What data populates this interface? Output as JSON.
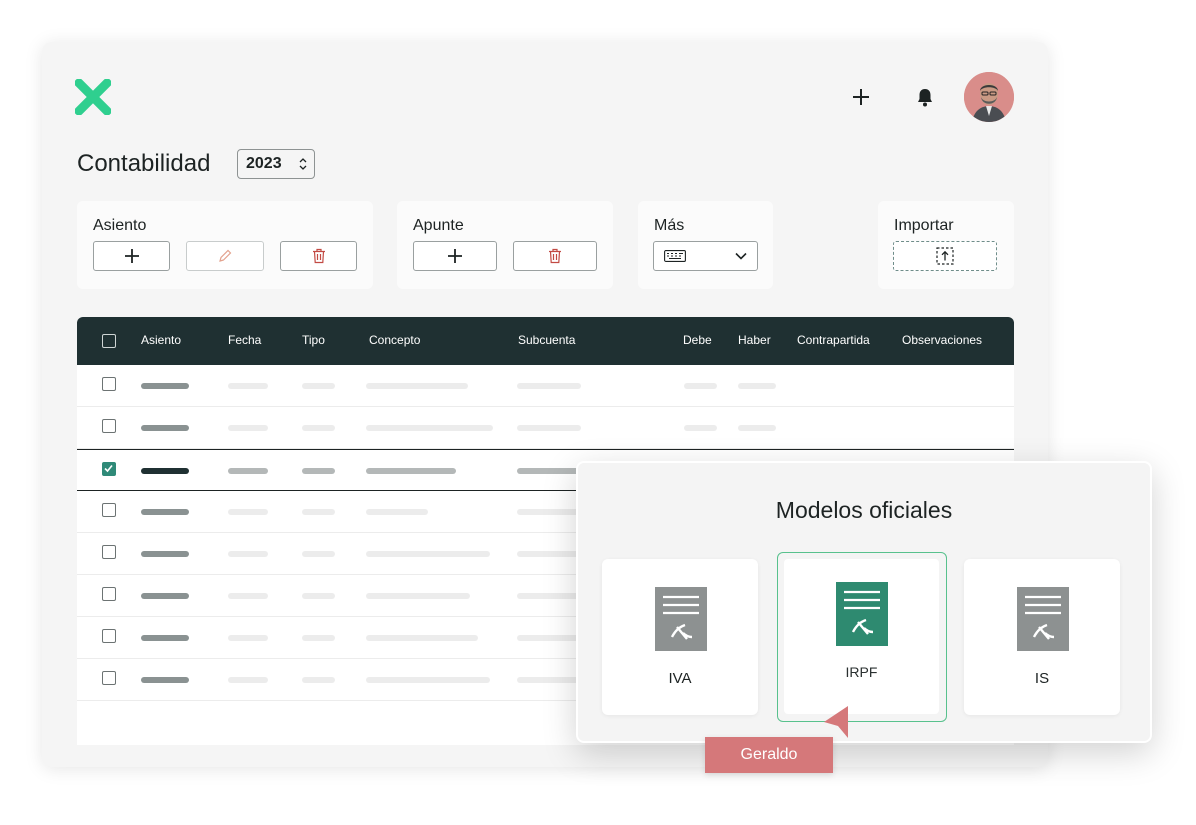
{
  "header": {
    "logo_icon": "x-logo-icon",
    "add_icon": "plus-icon",
    "notifications_icon": "bell-icon",
    "avatar": "user-avatar"
  },
  "page": {
    "title": "Contabilidad",
    "year_select": "2023"
  },
  "toolbar": {
    "asiento": {
      "title": "Asiento",
      "buttons": [
        "plus-icon",
        "pencil-icon",
        "trash-icon"
      ]
    },
    "apunte": {
      "title": "Apunte",
      "buttons": [
        "plus-icon",
        "trash-icon"
      ]
    },
    "mas": {
      "title": "Más",
      "select_icon": "keyboard-icon"
    },
    "importar": {
      "title": "Importar",
      "icon": "upload-icon"
    }
  },
  "table": {
    "columns": [
      "Asiento",
      "Fecha",
      "Tipo",
      "Concepto",
      "Subcuenta",
      "Debe",
      "Haber",
      "Contrapartida",
      "Observaciones"
    ],
    "rows": [
      {
        "checked": false
      },
      {
        "checked": false
      },
      {
        "checked": true
      },
      {
        "checked": false
      },
      {
        "checked": false
      },
      {
        "checked": false
      },
      {
        "checked": false
      },
      {
        "checked": false
      }
    ]
  },
  "modal": {
    "title": "Modelos oficiales",
    "cards": [
      {
        "label": "IVA",
        "icon": "tax-document-icon",
        "selected": false
      },
      {
        "label": "IRPF",
        "icon": "tax-document-icon",
        "selected": true
      },
      {
        "label": "IS",
        "icon": "tax-document-icon",
        "selected": false
      }
    ]
  },
  "collaborator_cursor": {
    "name": "Geraldo"
  },
  "colors": {
    "brand_green": "#2fcf8f",
    "header_dark": "#1f3032",
    "selected_model": "#2e8a70",
    "cursor_tag": "#d5787a"
  }
}
